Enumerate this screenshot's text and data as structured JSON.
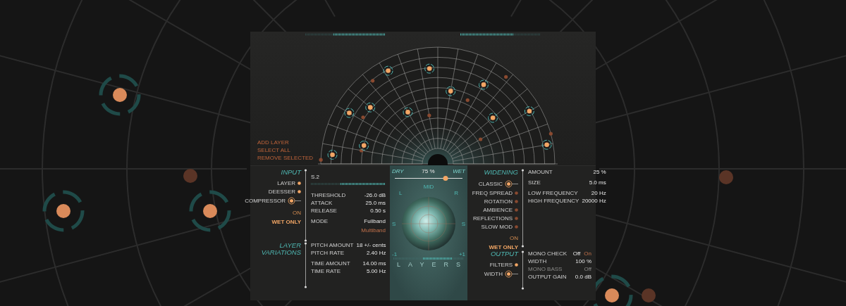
{
  "layer_actions": [
    {
      "label": "ADD LAYER"
    },
    {
      "label": "SELECT ALL"
    },
    {
      "label": "REMOVE SELECTED"
    }
  ],
  "input": {
    "title": "INPUT",
    "modules": [
      {
        "label": "LAYER",
        "on": true,
        "selected": false
      },
      {
        "label": "DEESSER",
        "on": true,
        "selected": false
      },
      {
        "label": "COMPRESSOR",
        "on": true,
        "selected": true
      }
    ],
    "routing": [
      {
        "label": "ON",
        "selected": false
      },
      {
        "label": "WET ONLY",
        "selected": true
      }
    ],
    "preset": "S.2",
    "preset_meter": {
      "level": 0.6
    },
    "groups": [
      [
        {
          "kind": "value",
          "label": "THRESHOLD",
          "value": "-26.0 dB"
        },
        {
          "kind": "value",
          "label": "ATTACK",
          "value": "25.0 ms"
        },
        {
          "kind": "value",
          "label": "RELEASE",
          "value": "0.50 s"
        }
      ],
      [
        {
          "kind": "options",
          "label": "MODE",
          "options": [
            {
              "label": "Fullband",
              "selected": true
            },
            {
              "label": "Multiband",
              "selected": false
            }
          ]
        }
      ]
    ]
  },
  "layer_variations": {
    "title": "LAYER VARIATIONS",
    "groups": [
      [
        {
          "kind": "value",
          "label": "PITCH AMOUNT",
          "value": "18 +/- cents"
        },
        {
          "kind": "value",
          "label": "PITCH RATE",
          "value": "2.40 Hz"
        }
      ],
      [
        {
          "kind": "value",
          "label": "TIME AMOUNT",
          "value": "14.00 ms"
        },
        {
          "kind": "value",
          "label": "TIME RATE",
          "value": "5.00 Hz"
        }
      ]
    ]
  },
  "mix": {
    "dry": "DRY",
    "value": "75 %",
    "wet": "WET",
    "level": 0.75
  },
  "scope": {
    "top": "MID",
    "left": "L",
    "right": "R",
    "side_left": "S",
    "side_right": "S",
    "minus": "-1",
    "plus": "+1",
    "footer": "LAYERS"
  },
  "widening": {
    "title": "WIDENING",
    "modules": [
      {
        "label": "CLASSIC",
        "on": true,
        "selected": true
      },
      {
        "label": "FREQ SPREAD",
        "on": false,
        "selected": false
      },
      {
        "label": "ROTATION",
        "on": false,
        "selected": false
      },
      {
        "label": "AMBIENCE",
        "on": false,
        "selected": false
      },
      {
        "label": "REFLECTIONS",
        "on": false,
        "selected": false
      },
      {
        "label": "SLOW MOD",
        "on": false,
        "selected": false
      }
    ],
    "routing": [
      {
        "label": "ON",
        "selected": false
      },
      {
        "label": "WET ONLY",
        "selected": true
      }
    ],
    "groups": [
      [
        {
          "kind": "value",
          "label": "AMOUNT",
          "value": "25 %"
        }
      ],
      [
        {
          "kind": "value",
          "label": "SIZE",
          "value": "5.0 ms"
        }
      ],
      [
        {
          "kind": "value",
          "label": "LOW FREQUENCY",
          "value": "20 Hz"
        },
        {
          "kind": "value",
          "label": "HIGH FREQUENCY",
          "value": "20000 Hz"
        }
      ]
    ]
  },
  "output": {
    "title": "OUTPUT",
    "modules": [
      {
        "label": "FILTERS",
        "on": true,
        "selected": false
      },
      {
        "label": "WIDTH",
        "on": true,
        "selected": true
      }
    ],
    "groups": [
      [
        {
          "kind": "options",
          "label": "MONO CHECK",
          "disabled": false,
          "options": [
            {
              "label": "Off",
              "selected": true
            },
            {
              "label": "On",
              "selected": false
            }
          ]
        },
        {
          "kind": "value",
          "label": "WIDTH",
          "value": "100 %",
          "disabled": false
        },
        {
          "kind": "value",
          "label": "MONO BASS",
          "value": "Off",
          "disabled": true
        },
        {
          "kind": "value",
          "label": "OUTPUT GAIN",
          "value": "0.0 dB",
          "disabled": false
        }
      ]
    ]
  }
}
